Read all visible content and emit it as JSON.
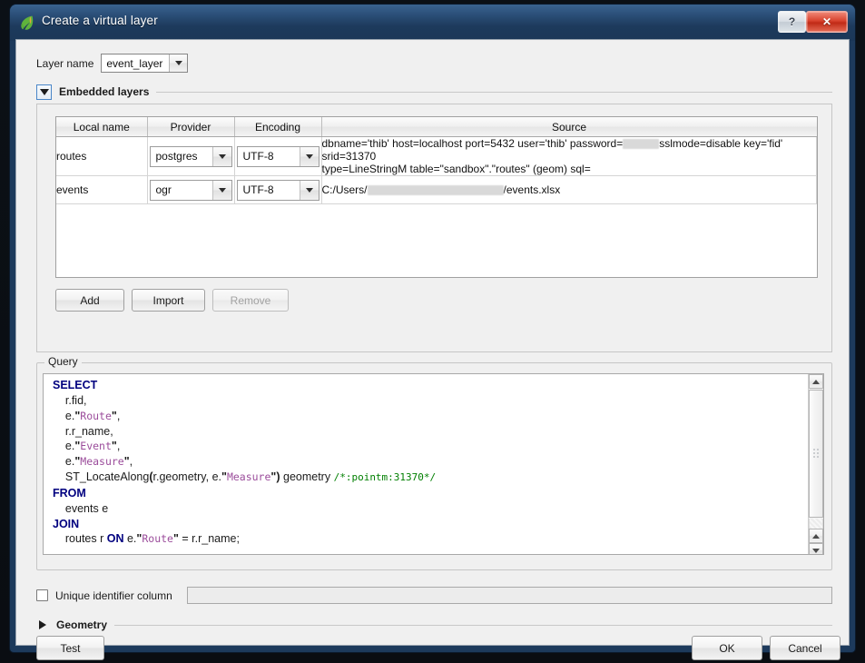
{
  "window": {
    "title": "Create a virtual layer",
    "icon": "qgis-leaf-icon",
    "help_label": "?",
    "close_label": "✕"
  },
  "layer_name": {
    "label": "Layer name",
    "value": "event_layer"
  },
  "embedded_layers": {
    "title": "Embedded layers",
    "expanded": true,
    "columns": [
      "Local name",
      "Provider",
      "Encoding",
      "Source"
    ],
    "rows": [
      {
        "local_name": "routes",
        "provider": "postgres",
        "encoding": "UTF-8",
        "source_line1_a": "dbname='thib' host=localhost port=5432 user='thib' password=",
        "source_line1_b": "sslmode=disable key='fid' srid=31370",
        "source_line2": "type=LineStringM table=\"sandbox\".\"routes\" (geom) sql=",
        "source_redacted": true
      },
      {
        "local_name": "events",
        "provider": "ogr",
        "encoding": "UTF-8",
        "source_line1_a": "C:/Users/",
        "source_line1_b": "/events.xlsx",
        "source_line2": "",
        "source_redacted": true
      }
    ],
    "buttons": {
      "add": "Add",
      "import": "Import",
      "remove": "Remove",
      "remove_disabled": true
    }
  },
  "query": {
    "legend": "Query",
    "sql_lines": [
      [
        {
          "t": "SELECT",
          "c": "kw"
        }
      ],
      [
        {
          "t": "    r.fid,",
          "c": ""
        }
      ],
      [
        {
          "t": "    e.",
          "c": ""
        },
        {
          "t": "\"",
          "c": "quot"
        },
        {
          "t": "Route",
          "c": "q"
        },
        {
          "t": "\"",
          "c": "quot"
        },
        {
          "t": ",",
          "c": ""
        }
      ],
      [
        {
          "t": "    r.r_name,",
          "c": ""
        }
      ],
      [
        {
          "t": "    e.",
          "c": ""
        },
        {
          "t": "\"",
          "c": "quot"
        },
        {
          "t": "Event",
          "c": "q"
        },
        {
          "t": "\"",
          "c": "quot"
        },
        {
          "t": ",",
          "c": ""
        }
      ],
      [
        {
          "t": "    e.",
          "c": ""
        },
        {
          "t": "\"",
          "c": "quot"
        },
        {
          "t": "Measure",
          "c": "q"
        },
        {
          "t": "\"",
          "c": "quot"
        },
        {
          "t": ",",
          "c": ""
        }
      ],
      [
        {
          "t": "    ST_LocateAlong",
          "c": ""
        },
        {
          "t": "(",
          "c": "par"
        },
        {
          "t": "r.geometry, e.",
          "c": ""
        },
        {
          "t": "\"",
          "c": "quot"
        },
        {
          "t": "Measure",
          "c": "q"
        },
        {
          "t": "\"",
          "c": "quot"
        },
        {
          "t": ")",
          "c": "par"
        },
        {
          "t": " geometry ",
          "c": ""
        },
        {
          "t": "/*:pointm:31370*/",
          "c": "cmt"
        }
      ],
      [
        {
          "t": "FROM",
          "c": "kw"
        }
      ],
      [
        {
          "t": "    events e",
          "c": ""
        }
      ],
      [
        {
          "t": "JOIN",
          "c": "kw"
        }
      ],
      [
        {
          "t": "    routes r ",
          "c": ""
        },
        {
          "t": "ON",
          "c": "kw"
        },
        {
          "t": " e.",
          "c": ""
        },
        {
          "t": "\"",
          "c": "quot"
        },
        {
          "t": "Route",
          "c": "q"
        },
        {
          "t": "\"",
          "c": "quot"
        },
        {
          "t": " = r.r_name;",
          "c": ""
        }
      ]
    ],
    "scrollbar": {
      "up_arrow": "▲",
      "down_arrow": "▼"
    }
  },
  "unique_identifier": {
    "label": "Unique identifier column",
    "checked": false,
    "value": "",
    "placeholder": "",
    "disabled": true
  },
  "geometry": {
    "title": "Geometry",
    "expanded": false
  },
  "footer": {
    "test": "Test",
    "ok": "OK",
    "cancel": "Cancel"
  },
  "colors": {
    "title_bar": "#1d3a5c",
    "close_button": "#c02a16",
    "accent_blue": "#4a86c8",
    "sql_keyword": "#00007f",
    "sql_string": "#9b4c9b",
    "sql_comment": "#007f00",
    "dialog_bg": "#f0f0f0"
  }
}
